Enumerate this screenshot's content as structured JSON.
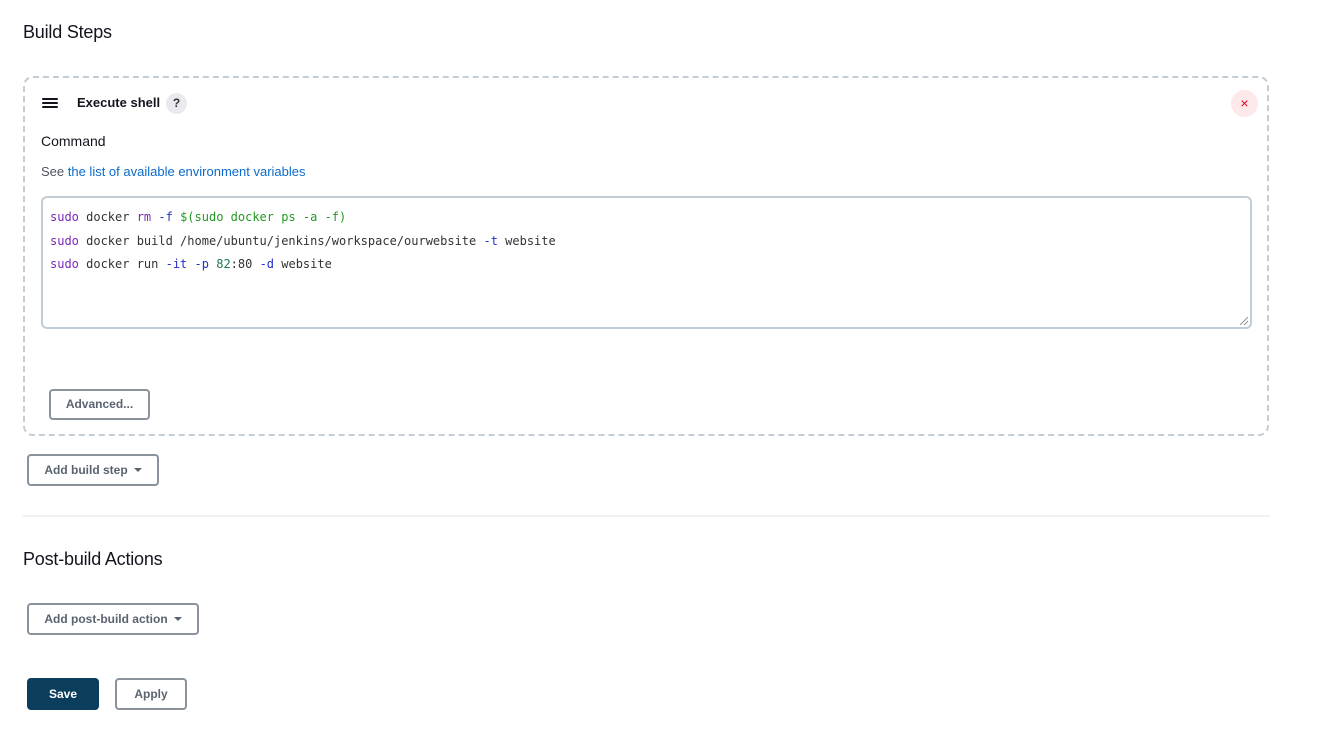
{
  "build_steps": {
    "title": "Build Steps",
    "step": {
      "title": "Execute shell",
      "help_label": "?",
      "close_label": "×",
      "command_label": "Command",
      "env_prefix": "See ",
      "env_link": "the list of available environment variables",
      "command_lines": [
        "sudo docker rm -f $(sudo docker ps -a -f)",
        "sudo docker build /home/ubuntu/jenkins/workspace/ourwebsite -t website",
        "sudo docker run -it -p 82:80 -d website"
      ],
      "advanced_label": "Advanced..."
    },
    "add_step_label": "Add build step"
  },
  "post_build": {
    "title": "Post-build Actions",
    "add_action_label": "Add post-build action"
  },
  "footer": {
    "save_label": "Save",
    "apply_label": "Apply"
  },
  "colors": {
    "primary": "#0b3d5c",
    "link": "#0b6bcb",
    "danger": "#e6001f"
  }
}
